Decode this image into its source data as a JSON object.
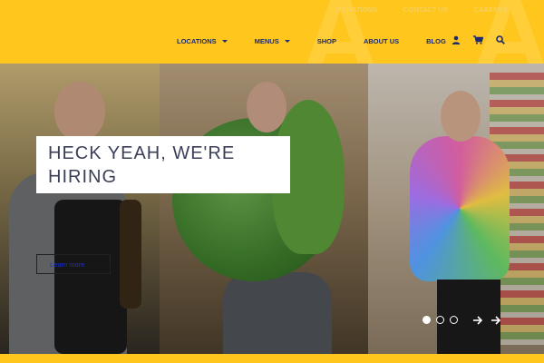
{
  "top_links": [
    "DONATIONS",
    "CONTACT US",
    "CAREERS"
  ],
  "nav": {
    "items": [
      {
        "label": "LOCATIONS",
        "has_dropdown": true
      },
      {
        "label": "MENUS",
        "has_dropdown": true
      },
      {
        "label": "SHOP",
        "has_dropdown": false
      },
      {
        "label": "ABOUT US",
        "has_dropdown": false
      },
      {
        "label": "BLOG",
        "has_dropdown": false
      }
    ],
    "icons": [
      "user-icon",
      "cart-icon",
      "search-icon"
    ]
  },
  "hero": {
    "headline_line1": "HECK YEAH, WE'RE",
    "headline_line2": "HIRING",
    "cta_label": "Learn more",
    "slide_dots": 3,
    "active_dot": 1
  },
  "colors": {
    "brand_yellow": "#ffc61e",
    "nav_text": "#1e2a6e",
    "headline_text": "#3a3f58",
    "link_blue": "#1b2fd6"
  }
}
